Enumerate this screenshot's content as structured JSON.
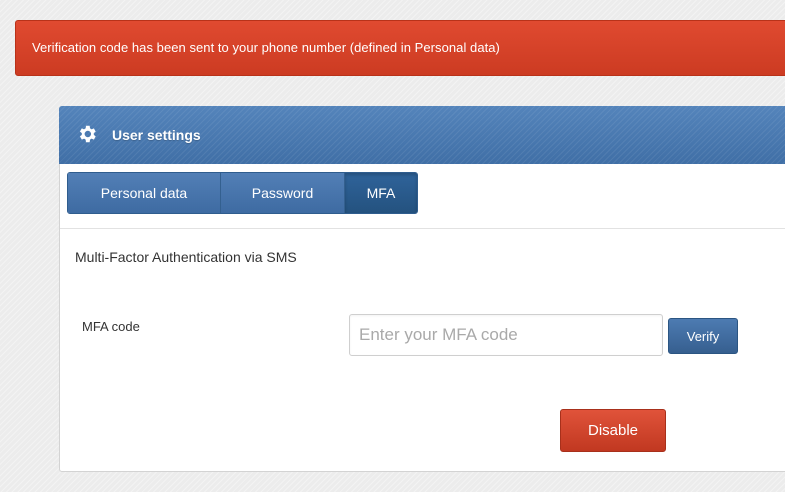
{
  "alert": {
    "message": "Verification code has been sent to your phone number (defined in Personal data)",
    "color": "#d9432b"
  },
  "panel": {
    "title": "User settings",
    "icon": "gear-icon",
    "header_color": "#4a7ab2"
  },
  "tabs": [
    {
      "label": "Personal data",
      "active": false
    },
    {
      "label": "Password",
      "active": false
    },
    {
      "label": "MFA",
      "active": true
    }
  ],
  "mfa": {
    "heading": "Multi-Factor Authentication via SMS",
    "field_label": "MFA code",
    "input_value": "",
    "input_placeholder": "Enter your MFA code",
    "verify_label": "Verify",
    "disable_label": "Disable"
  },
  "colors": {
    "primary": "#3f6ca1",
    "danger": "#d2452c"
  }
}
